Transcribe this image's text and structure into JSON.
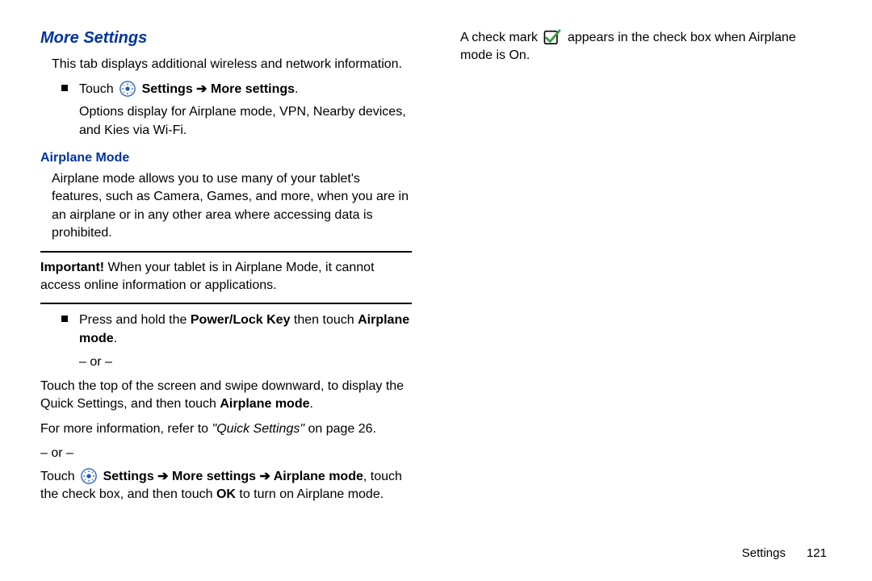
{
  "section_title": "More Settings",
  "intro": "This tab displays additional wireless and network information.",
  "bullet1": {
    "touch": "Touch ",
    "settings": "Settings",
    "arrow": " ➔ ",
    "more": "More settings",
    "period": ".",
    "options": "Options display for Airplane mode, VPN, Nearby devices, and Kies via Wi-Fi."
  },
  "airplane": {
    "title": "Airplane Mode",
    "intro": "Airplane mode allows you to use many of your tablet's features, such as Camera, Games, and more, when you are in an airplane or in any other area where accessing data is prohibited."
  },
  "important": {
    "label": "Important! ",
    "text": "When your tablet is in Airplane Mode, it cannot access online information or applications."
  },
  "bullet2": {
    "a": "Press and hold the ",
    "b": "Power/Lock Key",
    "c": " then touch ",
    "d": "Airplane mode",
    "e": "."
  },
  "or": "– or –",
  "col2": {
    "p1a": "Touch the top of the screen and swipe downward, to display the Quick Settings, and then touch ",
    "p1b": "Airplane mode",
    "p1c": ".",
    "p2a": "For more information, refer to ",
    "p2b": "\"Quick Settings\"",
    "p2c": " on page 26.",
    "p3_touch": "Touch ",
    "p3_settings": "Settings",
    "p3_arrow": " ➔ ",
    "p3_more": "More settings",
    "p3_airplane": "Airplane mode",
    "p3_tail1": ", touch the check box, and then touch ",
    "p3_ok": "OK",
    "p3_tail2": " to turn on Airplane mode.",
    "p4a": "A check mark ",
    "p4b": " appears in the check box when Airplane mode is On."
  },
  "footer": {
    "label": "Settings",
    "page": "121"
  }
}
